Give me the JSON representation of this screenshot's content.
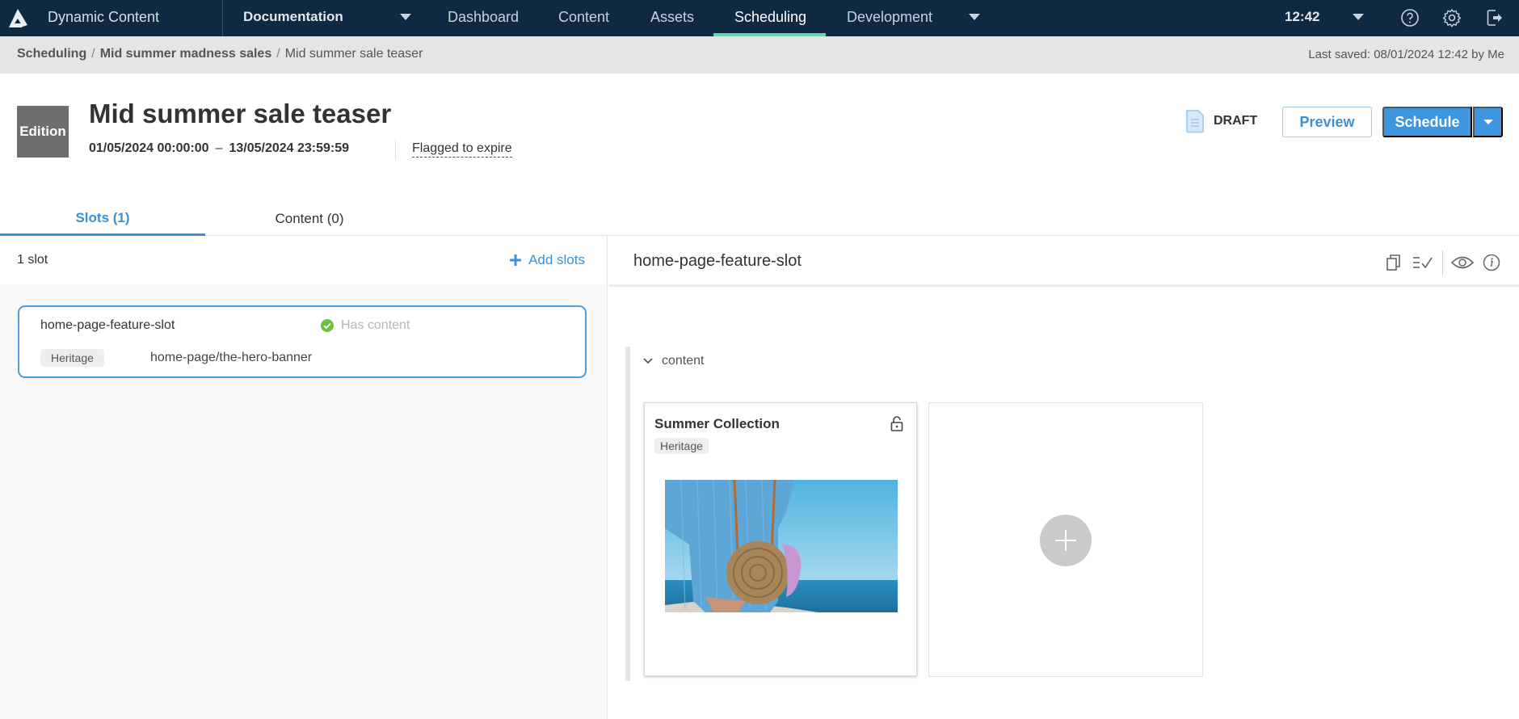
{
  "topnav": {
    "app_name": "Dynamic Content",
    "hub": "Documentation",
    "items": [
      {
        "label": "Dashboard",
        "active": false
      },
      {
        "label": "Content",
        "active": false
      },
      {
        "label": "Assets",
        "active": false
      },
      {
        "label": "Scheduling",
        "active": true
      },
      {
        "label": "Development",
        "active": false
      }
    ],
    "clock": "12:42",
    "icons": [
      "help-icon",
      "settings-gear-icon",
      "logout-icon"
    ],
    "accent_color": "#6bd4ad"
  },
  "breadcrumb": {
    "items": [
      "Scheduling",
      "Mid summer madness sales",
      "Mid summer sale teaser"
    ],
    "last_saved": "Last saved: 08/01/2024 12:42 by Me"
  },
  "header": {
    "badge": "Edition",
    "title": "Mid summer sale teaser",
    "start": "01/05/2024 00:00:00",
    "dash": "–",
    "end": "13/05/2024 23:59:59",
    "flag": "Flagged to expire",
    "status": "DRAFT",
    "preview_label": "Preview",
    "schedule_label": "Schedule",
    "primary_color": "#3e95e0"
  },
  "tabs": [
    {
      "label": "Slots (1)",
      "active": true
    },
    {
      "label": "Content (0)",
      "active": false
    }
  ],
  "left": {
    "count": "1 slot",
    "add_label": "Add slots",
    "slots": [
      {
        "name": "home-page-feature-slot",
        "status": "Has content",
        "tag": "Heritage",
        "path": "home-page/the-hero-banner"
      }
    ]
  },
  "right": {
    "title": "home-page-feature-slot",
    "toolbar_icons": [
      "copy-icon",
      "validate-list-icon",
      "preview-eye-icon",
      "info-icon"
    ],
    "section_label": "content",
    "card": {
      "title": "Summer Collection",
      "tag": "Heritage",
      "image": "woman-with-rattan-bag-at-sea"
    }
  }
}
